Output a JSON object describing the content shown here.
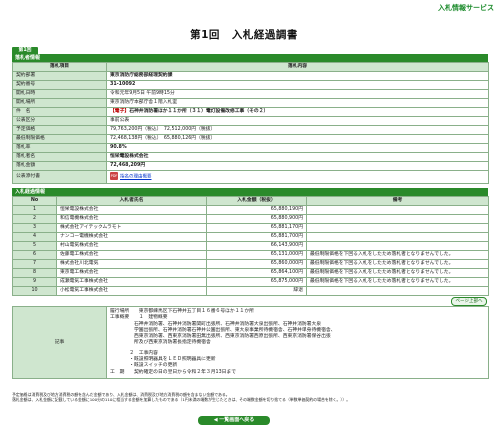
{
  "header": {
    "service_name": "入札情報サービス"
  },
  "page": {
    "title_round": "第1回",
    "title_text": "入札経過調書"
  },
  "round_tab": "第1回",
  "winner_section": {
    "heading": "落札者情報",
    "col_item": "落札項目",
    "col_content": "落札内容",
    "rows": [
      {
        "label": "契約部署",
        "value": "東京消防庁総務部経理契約課",
        "bold": true
      },
      {
        "label": "契約番号",
        "value": "31-10092",
        "bold": true
      },
      {
        "label": "開札日時",
        "value": "令和元年9月5日 午前9時15分",
        "bold": false
      },
      {
        "label": "開札場所",
        "value": "東京消防庁本部庁舎１階入札室",
        "bold": false
      },
      {
        "label": "件　名",
        "badge": "【電子】",
        "value": "石神井消防署ほか１１か所（３１）電灯設備改修工事（その２）",
        "bold": true
      },
      {
        "label": "公表区分",
        "value": "事前公表",
        "bold": false
      },
      {
        "label": "予定価格",
        "value": "79,763,200円（税込）　72,512,000円（税抜）",
        "bold": false
      },
      {
        "label": "最低制限価格",
        "value": "72,468,138円（税込）　65,880,126円（税抜）",
        "bold": false
      },
      {
        "label": "落札率",
        "value": "90.8%",
        "bold": true
      },
      {
        "label": "落札者名",
        "value": "恒栄電設株式会社",
        "bold": true
      },
      {
        "label": "落札金額",
        "value": "72,468,209円",
        "bold": true
      },
      {
        "label": "公表添付書",
        "link": "指名の理由概要",
        "bold": false
      }
    ]
  },
  "bids_section": {
    "heading": "入札経過情報",
    "col_no": "No",
    "col_name": "入札者氏名",
    "col_amount": "入札金額（税抜）",
    "col_note": "備考",
    "rows": [
      {
        "no": "1",
        "name": "恒栄電設株式会社",
        "amount": "65,880,190円",
        "note": ""
      },
      {
        "no": "2",
        "name": "和信電機株式会社",
        "amount": "65,880,900円",
        "note": ""
      },
      {
        "no": "3",
        "name": "株式会社アイテックムラモト",
        "amount": "65,881,170円",
        "note": ""
      },
      {
        "no": "4",
        "name": "ナンコー電機株式会社",
        "amount": "65,881,700円",
        "note": ""
      },
      {
        "no": "5",
        "name": "村山電気株式会社",
        "amount": "66,143,900円",
        "note": ""
      },
      {
        "no": "6",
        "name": "佐藤電工株式会社",
        "amount": "65,131,000円",
        "note": "最低制限価格を下回る入札をしたため落札者となりませんでした。"
      },
      {
        "no": "7",
        "name": "株式会社川北電気",
        "amount": "65,860,000円",
        "note": "最低制限価格を下回る入札をしたため落札者となりませんでした。"
      },
      {
        "no": "8",
        "name": "東京電工株式会社",
        "amount": "65,864,100円",
        "note": "最低制限価格を下回る入札をしたため落札者となりませんでした。"
      },
      {
        "no": "9",
        "name": "成瀬電気工事株式会社",
        "amount": "65,875,000円",
        "note": "最低制限価格を下回る入札をしたため落札者となりませんでした。"
      },
      {
        "no": "10",
        "name": "小松電気工事株式会社",
        "amount": "辞退",
        "note": ""
      }
    ],
    "pager_label": "ページ上部へ"
  },
  "remarks": {
    "label": "記事",
    "lines": [
      "履行場所　　東京都練馬区下石神井五丁目１６番６号ほか１１か所",
      "工事概要　　１　建物概要",
      "　　　　　石神井消防署、石神井消防署関町出張所、石神井消防署大泉出張所、石神井消防署大泉",
      "　　　　　学園出張所、石神井消防署石神井公園出張所、東大泉事業所待機宿舎、石神井単身待機宿舎、",
      "　　　　　西東京消防署、西東京消防署田無出張所、西東京消防署西原出張所、西東京消防署保谷出張",
      "　　　　　所及び西東京消防署長指定待機宿舎",
      "",
      "　　　　２　工事内容",
      "　　　　・既設照明器具をＬＥＤ照明器具に更新",
      "　　　　・既設スイッチの更新",
      "工　期　　契約確定の日の翌日から令和２年３月13日まで"
    ]
  },
  "notes": [
    "予定価格は消費税及び地方消費税の額を含んだ金額であり、入札金額は、消費税及び地方消費税の額を含まない金額である。",
    "落札金額は、入札金額に記載している金額に100分の110に相当する金額を加算したものである（1円未満の端数が生じたときは、その端数金額を切り捨てる（単数単価契約の場合を除く。））。"
  ],
  "back_button": "一覧画面へ戻る"
}
